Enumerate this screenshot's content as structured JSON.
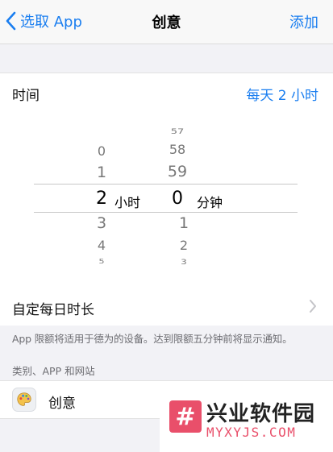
{
  "nav": {
    "back_label": "选取 App",
    "title": "创意",
    "add_label": "添加"
  },
  "time": {
    "label": "时间",
    "value": "每天 2 小时"
  },
  "picker": {
    "hours": [
      "0",
      "1",
      "2",
      "3",
      "4",
      "5"
    ],
    "hours_selected": "2",
    "hours_unit": "小时",
    "minutes": [
      "57",
      "58",
      "59",
      "0",
      "1",
      "2",
      "3"
    ],
    "minutes_selected": "0",
    "minutes_unit": "分钟"
  },
  "custom": {
    "label": "自定每日时长"
  },
  "note": "App 限额将适用于德为的设备。达到限额五分钟前将显示通知。",
  "section_header": "类别、APP 和网站",
  "app": {
    "name": "创意",
    "icon": "palette-icon"
  },
  "watermark": {
    "logo_glyph": "#",
    "cn": "兴业软件园",
    "en": "MYXYJS.COM"
  },
  "colors": {
    "accent": "#1a7ef0",
    "background": "#f2f2f6",
    "watermark": "#e94f6a"
  }
}
